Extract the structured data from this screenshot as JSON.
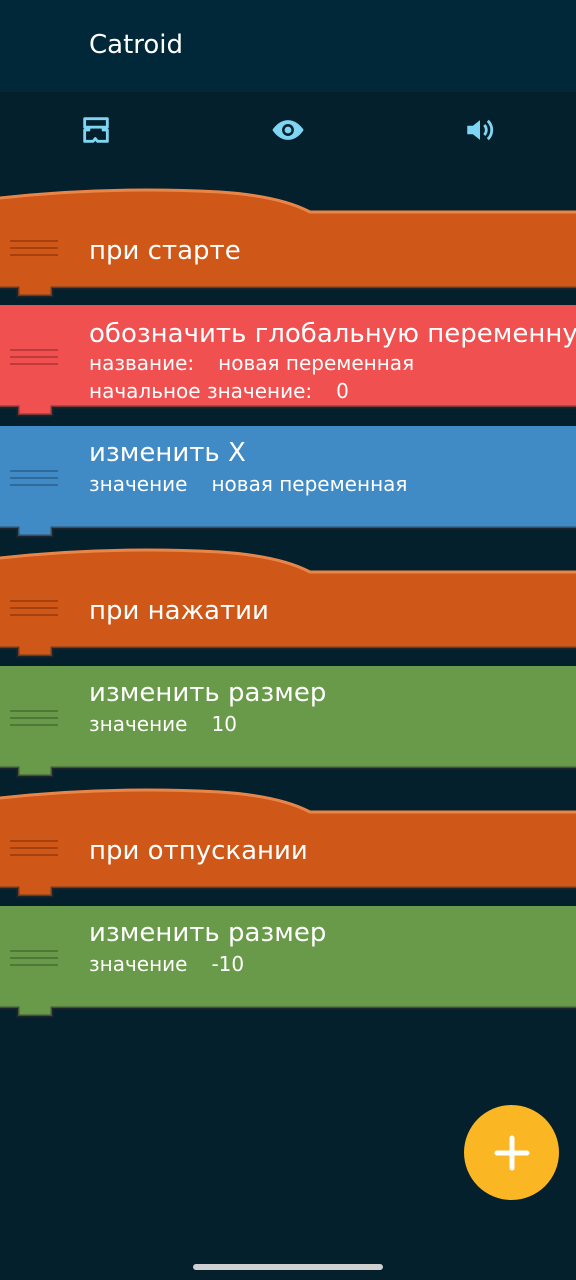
{
  "app": {
    "title": "Catroid"
  },
  "tabs": [
    {
      "name": "scripts",
      "icon": "scripts-icon"
    },
    {
      "name": "looks",
      "icon": "eye-icon"
    },
    {
      "name": "sounds",
      "icon": "speaker-icon"
    }
  ],
  "bricks": [
    {
      "type": "event",
      "label": "при старте",
      "color": "#cf5717"
    },
    {
      "type": "action",
      "label": "обозначить глобальную переменную",
      "color": "#f05050",
      "params": [
        {
          "label": "название:",
          "value": "новая переменная"
        },
        {
          "label": "начальное значение:",
          "value": "0"
        }
      ]
    },
    {
      "type": "action",
      "label": "изменить X",
      "color": "#408ac5",
      "params": [
        {
          "label": "значение",
          "value": "новая переменная"
        }
      ]
    },
    {
      "type": "event",
      "label": "при нажатии",
      "color": "#cf5717"
    },
    {
      "type": "action",
      "label": "изменить размер",
      "color": "#689a49",
      "params": [
        {
          "label": "значение",
          "value": "10"
        }
      ]
    },
    {
      "type": "event",
      "label": "при отпускании",
      "color": "#cf5717"
    },
    {
      "type": "action",
      "label": "изменить размер",
      "color": "#689a49",
      "params": [
        {
          "label": "значение",
          "value": "-10"
        }
      ]
    }
  ],
  "fab": {
    "icon": "plus-icon",
    "color": "#fbb624"
  }
}
